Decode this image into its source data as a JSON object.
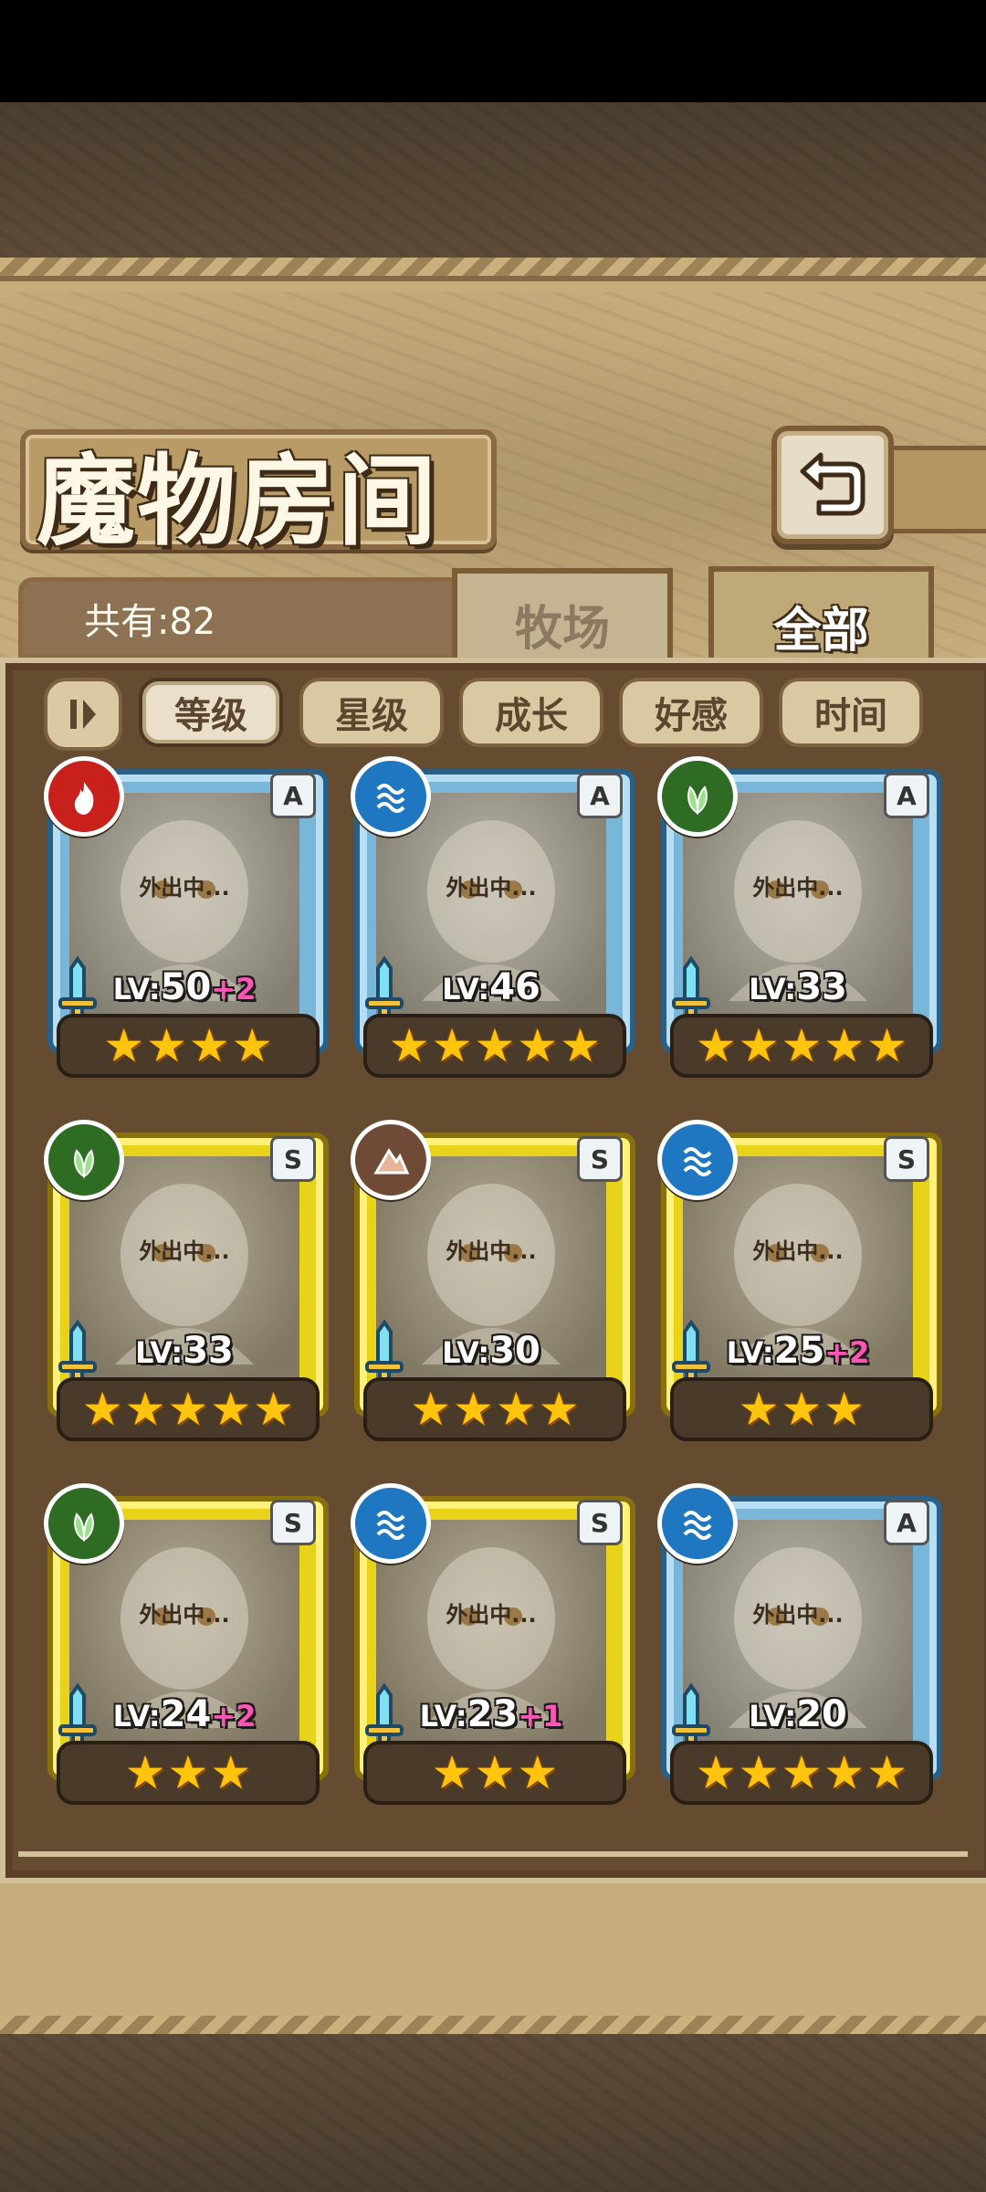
{
  "header": {
    "title": "魔物房间",
    "count_text": "共有:82",
    "back_icon": "back-arrow-icon"
  },
  "tabs": [
    {
      "label": "牧场",
      "active": false
    },
    {
      "label": "全部",
      "active": true
    }
  ],
  "filters": {
    "toggle_icon": "sort-toggle-icon",
    "items": [
      {
        "label": "等级",
        "active": true
      },
      {
        "label": "星级",
        "active": false
      },
      {
        "label": "成长",
        "active": false
      },
      {
        "label": "好感",
        "active": false
      },
      {
        "label": "时间",
        "active": false
      }
    ]
  },
  "monsters": [
    {
      "element": "fire",
      "rank": "A",
      "status": "外出中...",
      "level_label": "LV:",
      "level": "50",
      "bonus": "+2",
      "stars": 4
    },
    {
      "element": "water",
      "rank": "A",
      "status": "外出中...",
      "level_label": "LV:",
      "level": "46",
      "bonus": "",
      "stars": 5
    },
    {
      "element": "wood",
      "rank": "A",
      "status": "外出中...",
      "level_label": "LV:",
      "level": "33",
      "bonus": "",
      "stars": 5
    },
    {
      "element": "wood",
      "rank": "S",
      "status": "外出中...",
      "level_label": "LV:",
      "level": "33",
      "bonus": "",
      "stars": 5
    },
    {
      "element": "earth",
      "rank": "S",
      "status": "外出中...",
      "level_label": "LV:",
      "level": "30",
      "bonus": "",
      "stars": 4
    },
    {
      "element": "water",
      "rank": "S",
      "status": "外出中...",
      "level_label": "LV:",
      "level": "25",
      "bonus": "+2",
      "stars": 3
    },
    {
      "element": "wood",
      "rank": "S",
      "status": "外出中...",
      "level_label": "LV:",
      "level": "24",
      "bonus": "+2",
      "stars": 3
    },
    {
      "element": "water",
      "rank": "S",
      "status": "外出中...",
      "level_label": "LV:",
      "level": "23",
      "bonus": "+1",
      "stars": 3
    },
    {
      "element": "water",
      "rank": "A",
      "status": "外出中...",
      "level_label": "LV:",
      "level": "20",
      "bonus": "",
      "stars": 5
    }
  ],
  "colors": {
    "fire": "#c8201b",
    "water": "#1f77c2",
    "wood": "#2e6b23",
    "earth": "#6f4a36",
    "star": "#ffc40d",
    "bonus": "#ff55b8"
  }
}
